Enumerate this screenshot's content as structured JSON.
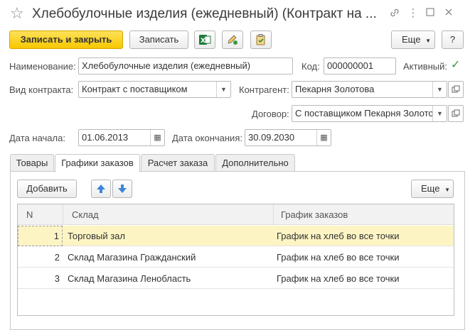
{
  "window": {
    "title": "Хлебобулочные изделия (ежедневный) (Контракт на ...",
    "star_icon": "star-icon",
    "link_icon": "link-icon",
    "more_icon": "more-vertical-icon",
    "maximize_icon": "maximize-icon",
    "close_icon": "close-icon"
  },
  "toolbar": {
    "save_close_label": "Записать и закрыть",
    "save_label": "Записать",
    "excel_icon": "excel-icon",
    "edit_icon": "edit-pencil-icon",
    "clipboard_icon": "clipboard-check-icon",
    "more_label": "Еще",
    "help_label": "?"
  },
  "form": {
    "name_label": "Наименование:",
    "name_value": "Хлебобулочные изделия (ежедневный)",
    "code_label": "Код:",
    "code_value": "000000001",
    "active_label": "Активный:",
    "active_checked": true,
    "contract_type_label": "Вид контракта:",
    "contract_type_value": "Контракт с поставщиком",
    "counterparty_label": "Контрагент:",
    "counterparty_value": "Пекарня Золотова",
    "agreement_label": "Договор:",
    "agreement_value": "С поставщиком Пекарня Золото",
    "start_date_label": "Дата начала:",
    "start_date_value": "01.06.2013",
    "end_date_label": "Дата окончания:",
    "end_date_value": "30.09.2030"
  },
  "tabs": [
    {
      "label": "Товары",
      "active": false
    },
    {
      "label": "Графики заказов",
      "active": true
    },
    {
      "label": "Расчет заказа",
      "active": false
    },
    {
      "label": "Дополнительно",
      "active": false
    }
  ],
  "panel": {
    "add_label": "Добавить",
    "more_label": "Еще"
  },
  "table": {
    "columns": [
      "N",
      "Склад",
      "График заказов"
    ],
    "rows": [
      {
        "n": "1",
        "warehouse": "Торговый зал",
        "schedule": "График на хлеб во все точки",
        "selected": true
      },
      {
        "n": "2",
        "warehouse": "Склад Магазина Гражданский",
        "schedule": "График на хлеб во все точки",
        "selected": false
      },
      {
        "n": "3",
        "warehouse": "Склад Магазина Ленобласть",
        "schedule": "График на хлеб во все точки",
        "selected": false
      }
    ]
  },
  "colors": {
    "primary_button": "#f6c700",
    "selected_row": "#fdf4c4",
    "arrow_blue": "#3d86d6",
    "checkbox_green": "#2e9b2e"
  }
}
